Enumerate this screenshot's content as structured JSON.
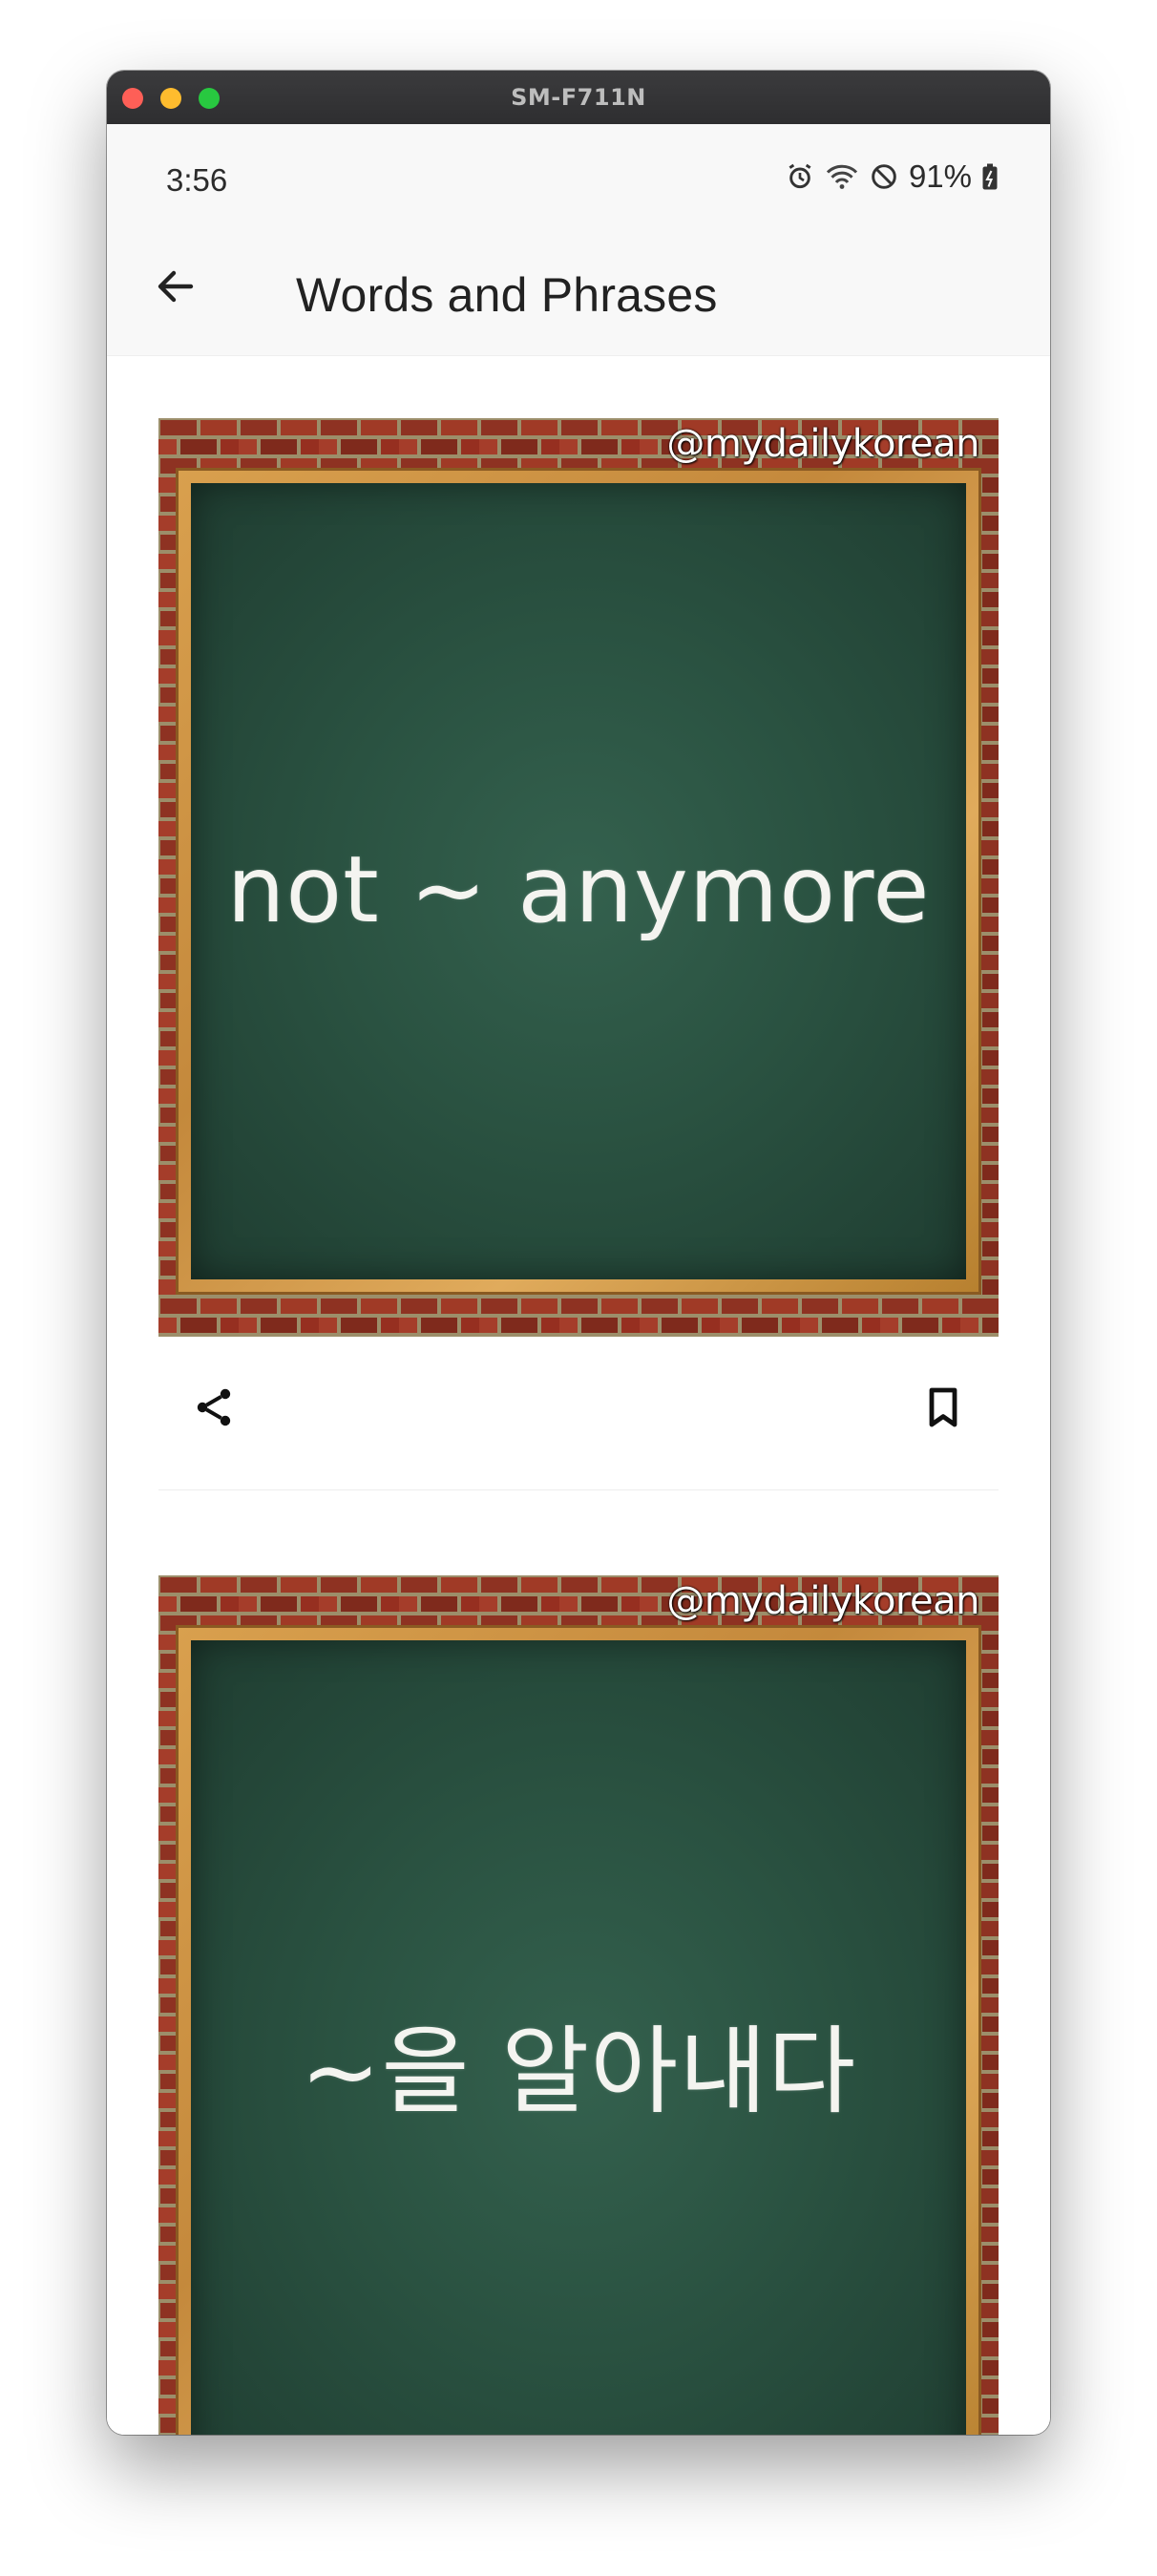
{
  "window": {
    "title": "SM-F711N"
  },
  "statusbar": {
    "time": "3:56",
    "battery": "91%"
  },
  "appbar": {
    "title": "Words and Phrases"
  },
  "cards": [
    {
      "watermark": "@mydailykorean",
      "text": "not ~ anymore"
    },
    {
      "watermark": "@mydailykorean",
      "text": "~을 알아내다"
    }
  ],
  "icons": {
    "back": "arrow-left-icon",
    "share": "share-icon",
    "bookmark": "bookmark-outline-icon",
    "alarm": "alarm-icon",
    "wifi": "wifi-icon",
    "dnd": "do-not-disturb-icon",
    "battery": "battery-charging-icon"
  },
  "colors": {
    "board": "#2a5241",
    "frame": "#d9a04e",
    "brick": "#7b2a1e",
    "appbar": "#f8f8f8"
  }
}
